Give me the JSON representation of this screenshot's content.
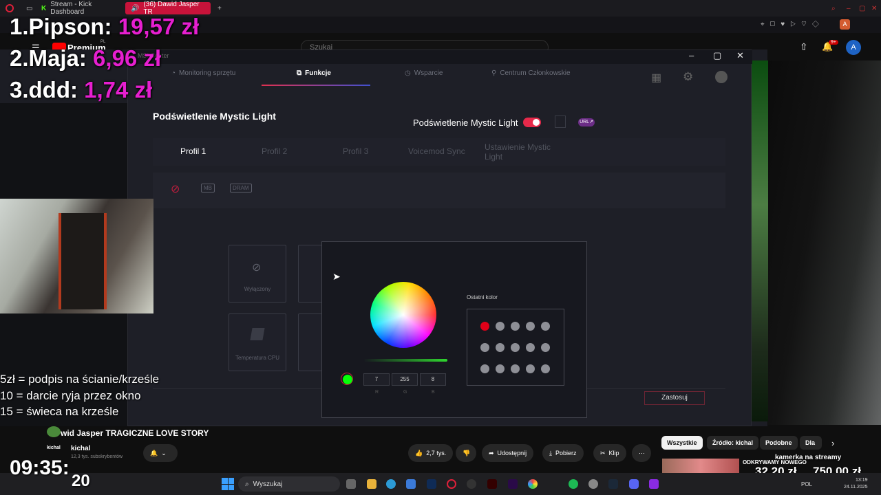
{
  "browser": {
    "tabs": [
      {
        "label": "Stream - Kick Dashboard"
      },
      {
        "label": "(36) Dawid Jasper TR"
      }
    ]
  },
  "youtube": {
    "logo": "Premium",
    "logo_region": "PL",
    "search_placeholder": "Szukaj",
    "notification_badge": "9+",
    "avatar_letter": "A"
  },
  "msi": {
    "window_title": "MSI Center",
    "nav": [
      "Monitoring sprzętu",
      "Funkcje",
      "Wsparcie",
      "Centrum Członkowskie"
    ],
    "section_title": "Podświetlenie Mystic Light",
    "toggle_label": "Podświetlenie Mystic Light",
    "url_badge": "URL↗",
    "profiles": [
      "Profil 1",
      "Profil 2",
      "Profil 3",
      "Voicemod Sync",
      "Ustawienie Mystic Light"
    ],
    "devices": [
      "MB",
      "DRAM"
    ],
    "effects": [
      {
        "label": "Wyłączony"
      },
      {
        "label": "Temperatura CPU"
      }
    ],
    "apply_label": "Zastosuj"
  },
  "color_picker": {
    "recent_title": "Ostatni kolor",
    "r": "7",
    "g": "255",
    "b": "8",
    "r_label": "R",
    "g_label": "G",
    "b_label": "B",
    "current_color": "#07ff08",
    "recent_colors": [
      "#e00018",
      "#8e8f96",
      "#8e8f96",
      "#8e8f96",
      "#8e8f96",
      "#8e8f96",
      "#8e8f96",
      "#8e8f96",
      "#8e8f96",
      "#8e8f96",
      "#8e8f96",
      "#8e8f96",
      "#8e8f96",
      "#8e8f96",
      "#8e8f96"
    ]
  },
  "overlay": {
    "leaderboard": [
      {
        "name": "1.Pipson:",
        "amount": "19,57 zł"
      },
      {
        "name": "2.Maja:",
        "amount": "6,96 zł"
      },
      {
        "name": "3.ddd:",
        "amount": "1,74 zł"
      }
    ],
    "goals": [
      "5zł = podpis na ścianie/krześle",
      "10 = darcie ryja przez okno",
      "15 = świeca na krześle"
    ],
    "clock": "09:35:",
    "clock_seconds": "20",
    "donation_left": "32,20 zł",
    "donation_right": "750,00 zł",
    "kamerka": "kamerka na streamy"
  },
  "video": {
    "title": "wid Jasper TRAGICZNE LOVE STORY",
    "channel": "kichal",
    "subscribers": "12,3 tys. subskrybentów",
    "likes": "2,7 tys.",
    "share": "Udostępnij",
    "download": "Pobierz",
    "clip": "Klip"
  },
  "chips": [
    "Wszystkie",
    "Źródło: kichal",
    "Podobne",
    "Dla C"
  ],
  "recommended_title": "ODKRYWAMY NOWEGO",
  "taskbar": {
    "search": "Wyszukaj",
    "lang": "POL",
    "time": "13:19",
    "date": "24.11.2025"
  }
}
